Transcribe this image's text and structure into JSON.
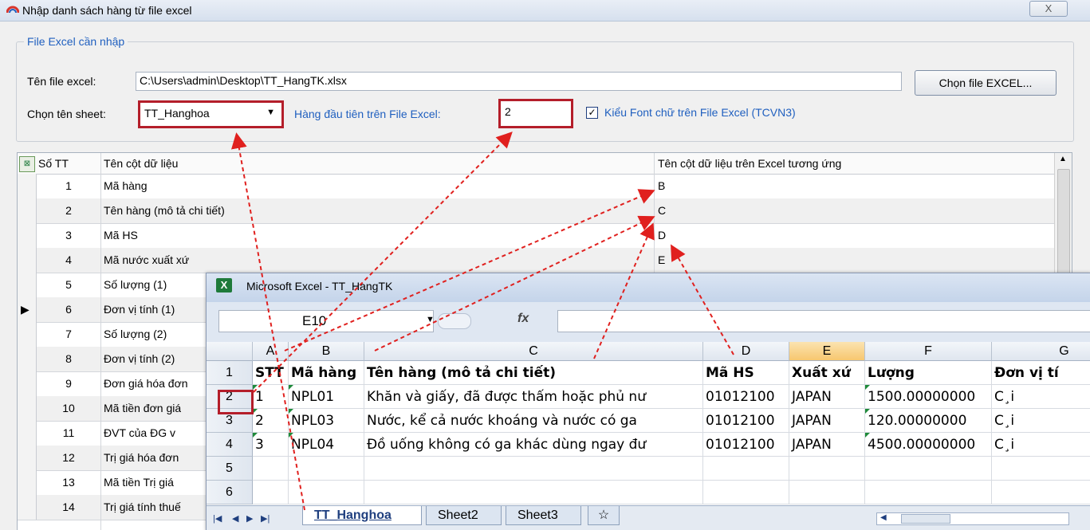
{
  "dialog": {
    "title": "Nhập danh sách hàng từ file excel",
    "close_label": "X",
    "group_label": "File Excel cần nhập",
    "file_label": "Tên file excel:",
    "file_value": "C:\\Users\\admin\\Desktop\\TT_HangTK.xlsx",
    "choose_button": "Chọn file EXCEL...",
    "sheet_label": "Chọn tên sheet:",
    "sheet_value": "TT_Hanghoa",
    "first_row_label": "Hàng đầu tiên trên File Excel:",
    "first_row_value": "2",
    "font_check_label": "Kiểu Font chữ trên File Excel (TCVN3)",
    "font_check_checked": true
  },
  "grid": {
    "headers": [
      "Số TT",
      "Tên cột dữ liệu",
      "Tên cột dữ liệu trên Excel tương ứng"
    ],
    "rows": [
      {
        "no": "1",
        "name": "Mã hàng",
        "col": "B"
      },
      {
        "no": "2",
        "name": "Tên hàng (mô tả chi tiết)",
        "col": "C"
      },
      {
        "no": "3",
        "name": "Mã HS",
        "col": "D"
      },
      {
        "no": "4",
        "name": "Mã nước xuất xứ",
        "col": "E"
      },
      {
        "no": "5",
        "name": "Số lượng (1)",
        "col": ""
      },
      {
        "no": "6",
        "name": "Đơn vị tính (1)",
        "col": ""
      },
      {
        "no": "7",
        "name": "Số lượng (2)",
        "col": ""
      },
      {
        "no": "8",
        "name": "Đơn vị tính (2)",
        "col": ""
      },
      {
        "no": "9",
        "name": "Đơn giá hóa đơn",
        "col": ""
      },
      {
        "no": "10",
        "name": "Mã tiền đơn giá",
        "col": ""
      },
      {
        "no": "11",
        "name": "ĐVT của ĐG v",
        "col": ""
      },
      {
        "no": "12",
        "name": "Trị giá hóa đơn",
        "col": ""
      },
      {
        "no": "13",
        "name": "Mã tiền Trị giá",
        "col": ""
      },
      {
        "no": "14",
        "name": "Trị giá tính thuế",
        "col": ""
      }
    ]
  },
  "excel": {
    "title": "Microsoft Excel - TT_HangTK",
    "name_box": "E10",
    "fx_label": "fx",
    "columns": [
      "A",
      "B",
      "C",
      "D",
      "E",
      "F",
      "G"
    ],
    "selected_column": "E",
    "row_numbers": [
      "1",
      "2",
      "3",
      "4",
      "5",
      "6"
    ],
    "header_row": [
      "STT",
      "Mã hàng",
      "Tên hàng (mô tả chi tiết)",
      "Mã HS",
      "Xuất xứ",
      "Lượng",
      "Đơn vị tí"
    ],
    "data_rows": [
      [
        "1",
        "NPL01",
        "Khăn và giấy, đã được thấm hoặc phủ nư",
        "01012100",
        "JAPAN",
        "1500.00000000",
        "C¸i"
      ],
      [
        "2",
        "NPL03",
        "Nước, kể cả nước khoáng và nước có ga",
        "01012100",
        "JAPAN",
        "120.00000000",
        "C¸i"
      ],
      [
        "3",
        "NPL04",
        "Đồ uống không có ga khác dùng ngay đư",
        "01012100",
        "JAPAN",
        "4500.00000000",
        "C¸i"
      ]
    ],
    "tabs": [
      "TT_Hanghoa",
      "Sheet2",
      "Sheet3"
    ],
    "active_tab": "TT_Hanghoa"
  },
  "colors": {
    "highlight_red": "#b41e2a",
    "accent_blue": "#1f5fbf",
    "excel_green": "#1e7a3a"
  }
}
